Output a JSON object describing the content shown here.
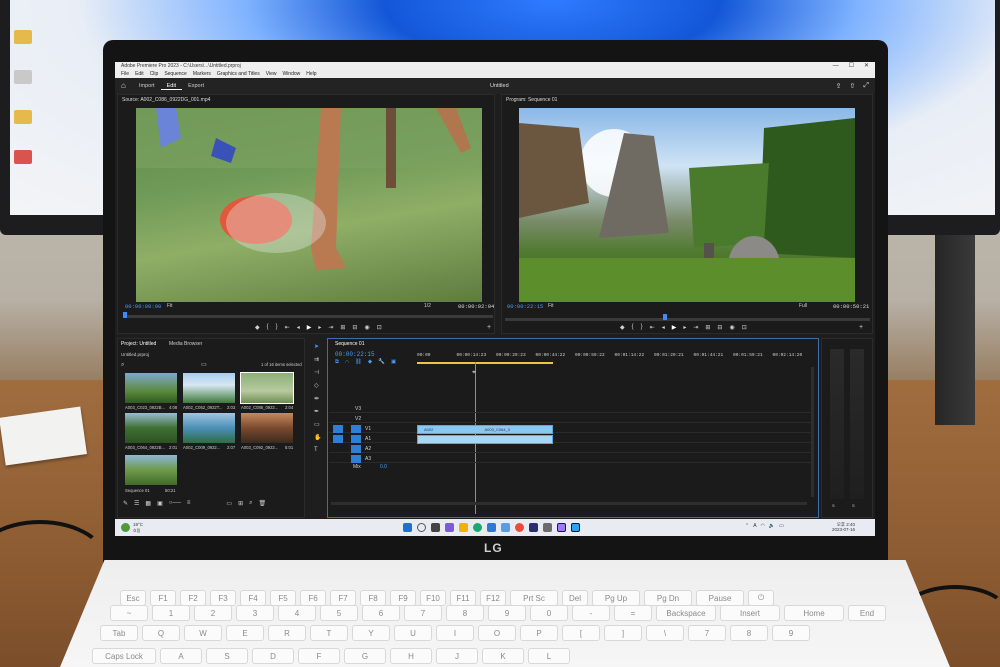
{
  "window": {
    "title": "Adobe Premiere Pro 2023 - C:\\Users\\...\\Untitled.prproj",
    "menu": [
      "File",
      "Edit",
      "Clip",
      "Sequence",
      "Markers",
      "Graphics and Titles",
      "View",
      "Window",
      "Help"
    ]
  },
  "workspace": {
    "tabs": [
      "Import",
      "Edit",
      "Export"
    ],
    "active_tab": "Edit",
    "document_title": "Untitled"
  },
  "source_monitor": {
    "title": "Source: A002_C086_0922DG_001.mp4",
    "timecode_in": "00:00:00:00",
    "fit": "Fit",
    "resolution": "1/2",
    "duration": "00:00:02:04"
  },
  "program_monitor": {
    "title": "Program: Sequence 01",
    "timecode": "00:00:22:15",
    "fit": "Fit",
    "quality": "Full",
    "duration": "00:00:50:21"
  },
  "project": {
    "tabs": [
      "Project: Untitled",
      "Media Browser"
    ],
    "file": "Untitled.prproj",
    "selection_status": "1 of 16 items selected",
    "items": [
      {
        "label": "A003_C023_0922B...",
        "dur": "4:08"
      },
      {
        "label": "A002_C052_0922T...",
        "dur": "2:03"
      },
      {
        "label": "A002_C086_0922...",
        "dur": "2:04"
      },
      {
        "label": "A003_C064_0922B...",
        "dur": "2:01"
      },
      {
        "label": "A002_C009_0922...",
        "dur": "2:07"
      },
      {
        "label": "A003_C092_0922...",
        "dur": "5:01"
      },
      {
        "label": "Sequence 01",
        "dur": "50:21"
      }
    ]
  },
  "timeline": {
    "tab": "Sequence 01",
    "timecode": "00:00:22:15",
    "ruler": [
      "00:00",
      "00:00:14:23",
      "00:00:29:23",
      "00:00:44:22",
      "00:00:59:22",
      "00:01:14:22",
      "00:01:29:21",
      "00:01:44:21",
      "00:01:59:21",
      "00:02:14:20"
    ],
    "tracks": [
      "V3",
      "V2",
      "V1",
      "A1",
      "A2",
      "A3"
    ],
    "mix_label": "Mix",
    "mix_value": "0.0",
    "clip_labels": [
      "A002",
      "A003_C064_0"
    ]
  },
  "audio_meter": {
    "labels": [
      "S",
      "S"
    ]
  },
  "taskbar": {
    "weather": "19°C",
    "weather_sub": "흐림",
    "time": "오후 2:40",
    "date": "2023-07-16"
  },
  "laptop": {
    "brand": "LG"
  },
  "keyboard": {
    "row1": [
      "Esc",
      "F1",
      "F2",
      "F3",
      "F4",
      "F5",
      "F6",
      "F7",
      "F8",
      "F9",
      "F10",
      "F11",
      "F12",
      "Prt Sc",
      "Del",
      "Pg Up",
      "Pg Dn",
      "Pause",
      "⏻"
    ],
    "row2": [
      "~",
      "1",
      "2",
      "3",
      "4",
      "5",
      "6",
      "7",
      "8",
      "9",
      "0",
      "-",
      "=",
      "Backspace",
      "Insert",
      "Home",
      "End"
    ],
    "row3": [
      "Tab",
      "Q",
      "W",
      "E",
      "R",
      "T",
      "Y",
      "U",
      "I",
      "O",
      "P",
      "[",
      "]",
      "\\",
      "7",
      "8",
      "9"
    ],
    "row4": [
      "Caps Lock",
      "A",
      "S",
      "D",
      "F",
      "G",
      "H",
      "J",
      "K",
      "L"
    ]
  },
  "colors": {
    "accent_blue": "#3d8bff",
    "clip_blue": "#8cc7ee",
    "panel_bg": "#1b1b1b"
  }
}
